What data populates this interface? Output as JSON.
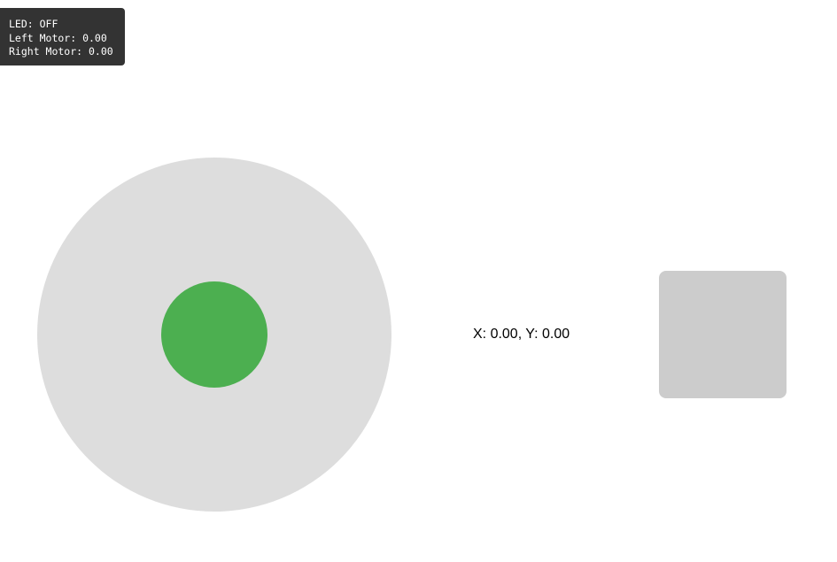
{
  "status": {
    "led_text": "LED: OFF",
    "left_motor_text": "Left Motor: 0.00",
    "right_motor_text": "Right Motor: 0.00"
  },
  "joystick": {
    "x": 0.0,
    "y": 0.0,
    "base_color": "#dddddd",
    "knob_color": "#4caf50"
  },
  "coords_text": "X: 0.00, Y: 0.00",
  "led_button": {
    "state": "off",
    "off_color": "#cccccc"
  }
}
